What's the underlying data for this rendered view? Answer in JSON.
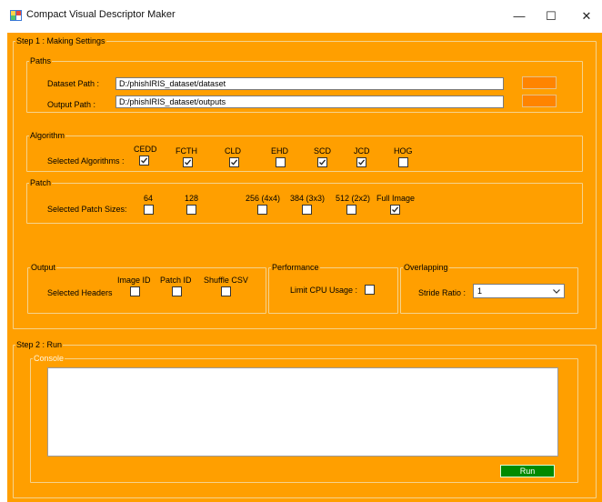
{
  "window": {
    "title": "Compact Visual Descriptor Maker",
    "minimize_glyph": "—",
    "maximize_glyph": "☐",
    "close_glyph": "✕"
  },
  "step1": {
    "legend": "Step 1 : Making Settings",
    "paths": {
      "legend": "Paths",
      "dataset_label": "Dataset Path :",
      "dataset_value": "D:/phishIRIS_dataset/dataset",
      "output_label": "Output Path :",
      "output_value": "D:/phishIRIS_dataset/outputs"
    },
    "algorithm": {
      "legend": "Algorithm",
      "row_label": "Selected Algorithms :",
      "items": [
        {
          "label": "CEDD",
          "checked": true
        },
        {
          "label": "FCTH",
          "checked": true
        },
        {
          "label": "CLD",
          "checked": true
        },
        {
          "label": "EHD",
          "checked": false
        },
        {
          "label": "SCD",
          "checked": true
        },
        {
          "label": "JCD",
          "checked": true
        },
        {
          "label": "HOG",
          "checked": false
        }
      ]
    },
    "patch": {
      "legend": "Patch",
      "row_label": "Selected Patch Sizes:",
      "items": [
        {
          "label": "64",
          "checked": false
        },
        {
          "label": "128",
          "checked": false
        },
        {
          "label": "256 (4x4)",
          "checked": false
        },
        {
          "label": "384 (3x3)",
          "checked": false
        },
        {
          "label": "512 (2x2)",
          "checked": false
        },
        {
          "label": "Full Image",
          "checked": true
        }
      ]
    },
    "output": {
      "legend": "Output",
      "row_label": "Selected Headers",
      "items": [
        {
          "label": "Image ID",
          "checked": false
        },
        {
          "label": "Patch ID",
          "checked": false
        },
        {
          "label": "Shuffle CSV",
          "checked": false
        }
      ]
    },
    "performance": {
      "legend": "Performance",
      "limit_cpu_label": "Limit CPU Usage :",
      "limit_cpu_checked": false
    },
    "overlapping": {
      "legend": "Overlapping",
      "stride_label": "Stride Ratio :",
      "stride_value": "1"
    }
  },
  "step2": {
    "legend": "Step 2 : Run",
    "console_legend": "Console",
    "console_text": "",
    "run_label": "Run"
  }
}
